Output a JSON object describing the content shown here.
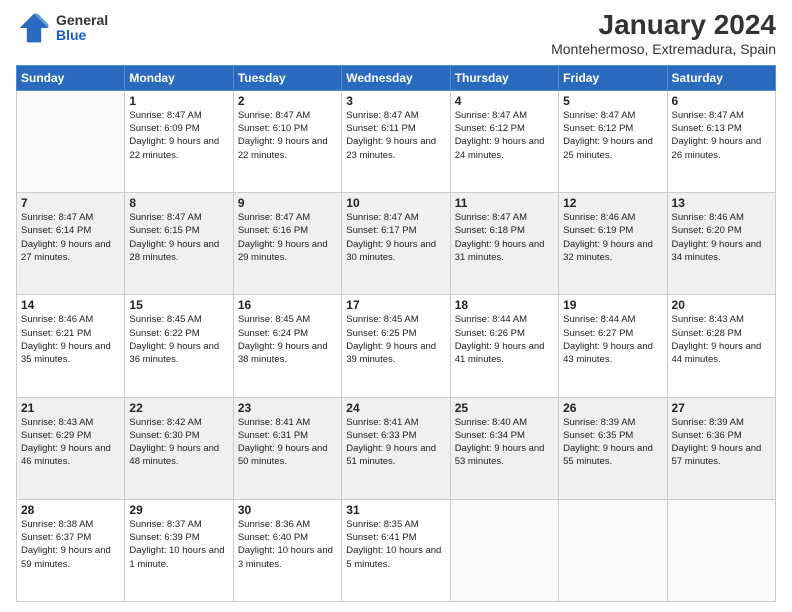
{
  "header": {
    "logo_general": "General",
    "logo_blue": "Blue",
    "title": "January 2024",
    "subtitle": "Montehermoso, Extremadura, Spain"
  },
  "weekdays": [
    "Sunday",
    "Monday",
    "Tuesday",
    "Wednesday",
    "Thursday",
    "Friday",
    "Saturday"
  ],
  "weeks": [
    [
      {
        "day": "",
        "sunrise": "",
        "sunset": "",
        "daylight": ""
      },
      {
        "day": "1",
        "sunrise": "Sunrise: 8:47 AM",
        "sunset": "Sunset: 6:09 PM",
        "daylight": "Daylight: 9 hours and 22 minutes."
      },
      {
        "day": "2",
        "sunrise": "Sunrise: 8:47 AM",
        "sunset": "Sunset: 6:10 PM",
        "daylight": "Daylight: 9 hours and 22 minutes."
      },
      {
        "day": "3",
        "sunrise": "Sunrise: 8:47 AM",
        "sunset": "Sunset: 6:11 PM",
        "daylight": "Daylight: 9 hours and 23 minutes."
      },
      {
        "day": "4",
        "sunrise": "Sunrise: 8:47 AM",
        "sunset": "Sunset: 6:12 PM",
        "daylight": "Daylight: 9 hours and 24 minutes."
      },
      {
        "day": "5",
        "sunrise": "Sunrise: 8:47 AM",
        "sunset": "Sunset: 6:12 PM",
        "daylight": "Daylight: 9 hours and 25 minutes."
      },
      {
        "day": "6",
        "sunrise": "Sunrise: 8:47 AM",
        "sunset": "Sunset: 6:13 PM",
        "daylight": "Daylight: 9 hours and 26 minutes."
      }
    ],
    [
      {
        "day": "7",
        "sunrise": "Sunrise: 8:47 AM",
        "sunset": "Sunset: 6:14 PM",
        "daylight": "Daylight: 9 hours and 27 minutes."
      },
      {
        "day": "8",
        "sunrise": "Sunrise: 8:47 AM",
        "sunset": "Sunset: 6:15 PM",
        "daylight": "Daylight: 9 hours and 28 minutes."
      },
      {
        "day": "9",
        "sunrise": "Sunrise: 8:47 AM",
        "sunset": "Sunset: 6:16 PM",
        "daylight": "Daylight: 9 hours and 29 minutes."
      },
      {
        "day": "10",
        "sunrise": "Sunrise: 8:47 AM",
        "sunset": "Sunset: 6:17 PM",
        "daylight": "Daylight: 9 hours and 30 minutes."
      },
      {
        "day": "11",
        "sunrise": "Sunrise: 8:47 AM",
        "sunset": "Sunset: 6:18 PM",
        "daylight": "Daylight: 9 hours and 31 minutes."
      },
      {
        "day": "12",
        "sunrise": "Sunrise: 8:46 AM",
        "sunset": "Sunset: 6:19 PM",
        "daylight": "Daylight: 9 hours and 32 minutes."
      },
      {
        "day": "13",
        "sunrise": "Sunrise: 8:46 AM",
        "sunset": "Sunset: 6:20 PM",
        "daylight": "Daylight: 9 hours and 34 minutes."
      }
    ],
    [
      {
        "day": "14",
        "sunrise": "Sunrise: 8:46 AM",
        "sunset": "Sunset: 6:21 PM",
        "daylight": "Daylight: 9 hours and 35 minutes."
      },
      {
        "day": "15",
        "sunrise": "Sunrise: 8:45 AM",
        "sunset": "Sunset: 6:22 PM",
        "daylight": "Daylight: 9 hours and 36 minutes."
      },
      {
        "day": "16",
        "sunrise": "Sunrise: 8:45 AM",
        "sunset": "Sunset: 6:24 PM",
        "daylight": "Daylight: 9 hours and 38 minutes."
      },
      {
        "day": "17",
        "sunrise": "Sunrise: 8:45 AM",
        "sunset": "Sunset: 6:25 PM",
        "daylight": "Daylight: 9 hours and 39 minutes."
      },
      {
        "day": "18",
        "sunrise": "Sunrise: 8:44 AM",
        "sunset": "Sunset: 6:26 PM",
        "daylight": "Daylight: 9 hours and 41 minutes."
      },
      {
        "day": "19",
        "sunrise": "Sunrise: 8:44 AM",
        "sunset": "Sunset: 6:27 PM",
        "daylight": "Daylight: 9 hours and 43 minutes."
      },
      {
        "day": "20",
        "sunrise": "Sunrise: 8:43 AM",
        "sunset": "Sunset: 6:28 PM",
        "daylight": "Daylight: 9 hours and 44 minutes."
      }
    ],
    [
      {
        "day": "21",
        "sunrise": "Sunrise: 8:43 AM",
        "sunset": "Sunset: 6:29 PM",
        "daylight": "Daylight: 9 hours and 46 minutes."
      },
      {
        "day": "22",
        "sunrise": "Sunrise: 8:42 AM",
        "sunset": "Sunset: 6:30 PM",
        "daylight": "Daylight: 9 hours and 48 minutes."
      },
      {
        "day": "23",
        "sunrise": "Sunrise: 8:41 AM",
        "sunset": "Sunset: 6:31 PM",
        "daylight": "Daylight: 9 hours and 50 minutes."
      },
      {
        "day": "24",
        "sunrise": "Sunrise: 8:41 AM",
        "sunset": "Sunset: 6:33 PM",
        "daylight": "Daylight: 9 hours and 51 minutes."
      },
      {
        "day": "25",
        "sunrise": "Sunrise: 8:40 AM",
        "sunset": "Sunset: 6:34 PM",
        "daylight": "Daylight: 9 hours and 53 minutes."
      },
      {
        "day": "26",
        "sunrise": "Sunrise: 8:39 AM",
        "sunset": "Sunset: 6:35 PM",
        "daylight": "Daylight: 9 hours and 55 minutes."
      },
      {
        "day": "27",
        "sunrise": "Sunrise: 8:39 AM",
        "sunset": "Sunset: 6:36 PM",
        "daylight": "Daylight: 9 hours and 57 minutes."
      }
    ],
    [
      {
        "day": "28",
        "sunrise": "Sunrise: 8:38 AM",
        "sunset": "Sunset: 6:37 PM",
        "daylight": "Daylight: 9 hours and 59 minutes."
      },
      {
        "day": "29",
        "sunrise": "Sunrise: 8:37 AM",
        "sunset": "Sunset: 6:39 PM",
        "daylight": "Daylight: 10 hours and 1 minute."
      },
      {
        "day": "30",
        "sunrise": "Sunrise: 8:36 AM",
        "sunset": "Sunset: 6:40 PM",
        "daylight": "Daylight: 10 hours and 3 minutes."
      },
      {
        "day": "31",
        "sunrise": "Sunrise: 8:35 AM",
        "sunset": "Sunset: 6:41 PM",
        "daylight": "Daylight: 10 hours and 5 minutes."
      },
      {
        "day": "",
        "sunrise": "",
        "sunset": "",
        "daylight": ""
      },
      {
        "day": "",
        "sunrise": "",
        "sunset": "",
        "daylight": ""
      },
      {
        "day": "",
        "sunrise": "",
        "sunset": "",
        "daylight": ""
      }
    ]
  ]
}
